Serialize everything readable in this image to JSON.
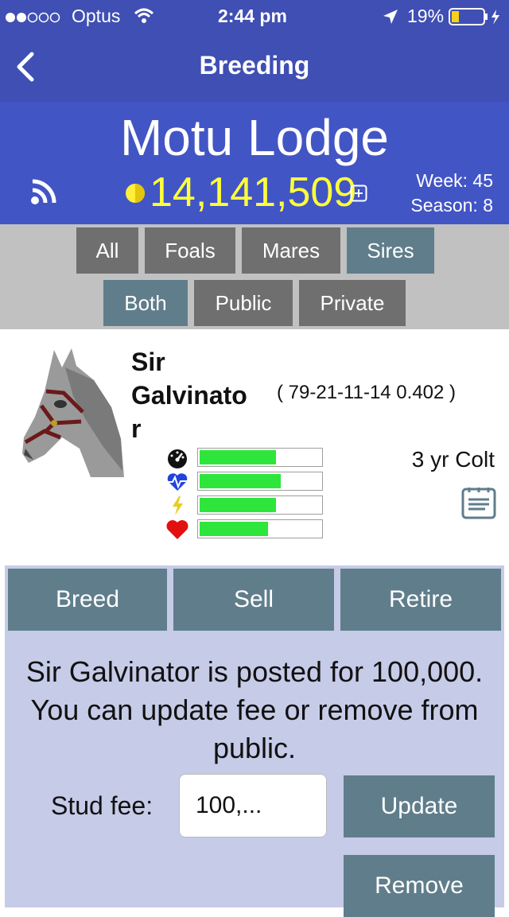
{
  "status_bar": {
    "carrier": "Optus",
    "time": "2:44 pm",
    "battery": "19%"
  },
  "nav": {
    "title": "Breeding"
  },
  "stable": {
    "name": "Motu Lodge",
    "money": "14,141,509",
    "week": "Week: 45",
    "season": "Season: 8"
  },
  "filters": {
    "row1": [
      "All",
      "Foals",
      "Mares",
      "Sires"
    ],
    "row2": [
      "Both",
      "Public",
      "Private"
    ],
    "active_row1": "Sires",
    "active_row2": "Both"
  },
  "horse": {
    "name_line1": "Sir",
    "name_line2": "Galvinato",
    "name_line3": "r",
    "record": "( 79-21-11-14 0.402 )",
    "age_sex": "3 yr Colt",
    "stats": [
      {
        "icon": "speedometer-icon",
        "fill": 0.64
      },
      {
        "icon": "heartbeat-icon",
        "fill": 0.68
      },
      {
        "icon": "lightning-icon",
        "fill": 0.64
      },
      {
        "icon": "heart-icon",
        "fill": 0.58
      }
    ]
  },
  "actions": {
    "breed": "Breed",
    "sell": "Sell",
    "retire": "Retire"
  },
  "info_text": "Sir Galvinator is posted for 100,000. You can update fee or remove from public.",
  "stud": {
    "label": "Stud fee:",
    "value": "100,...",
    "update": "Update",
    "remove": "Remove"
  },
  "colors": {
    "nav_bg": "#3f4fb3",
    "header_bg": "#4255c5",
    "money": "#ffff3a",
    "filter_btn": "#6f6f6f",
    "filter_active": "#607d8b",
    "action_btn": "#607d8b",
    "panel_bg": "#c6cbe8",
    "stat_fill": "#2ee63b"
  }
}
